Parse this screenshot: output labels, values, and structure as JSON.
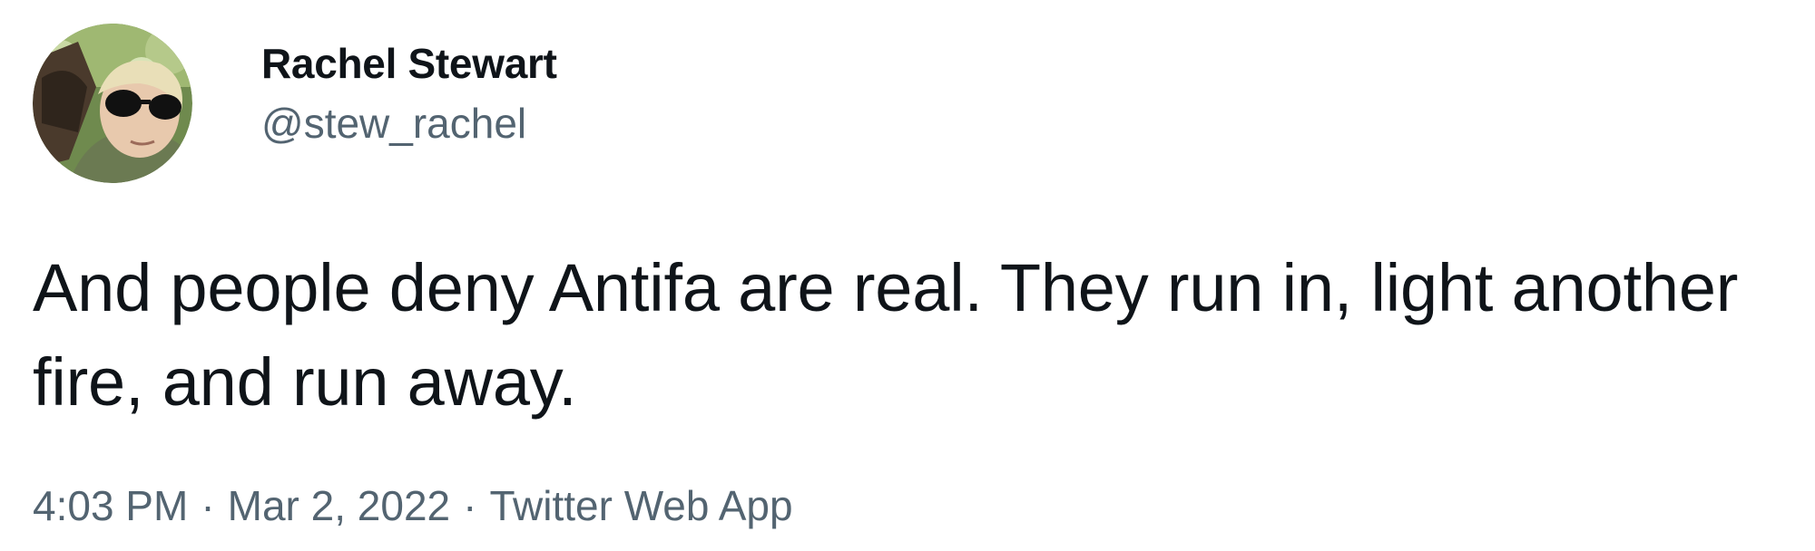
{
  "author": {
    "display_name": "Rachel Stewart",
    "handle": "@stew_rachel",
    "avatar_icon": "profile-photo"
  },
  "tweet": {
    "text": "And people deny Antifa are real. They run in, light another fire, and run away."
  },
  "meta": {
    "time": "4:03 PM",
    "separator": "·",
    "date": "Mar 2, 2022",
    "source": "Twitter Web App"
  },
  "colors": {
    "text_primary": "#0f1419",
    "text_secondary": "#536471",
    "background": "#ffffff"
  }
}
